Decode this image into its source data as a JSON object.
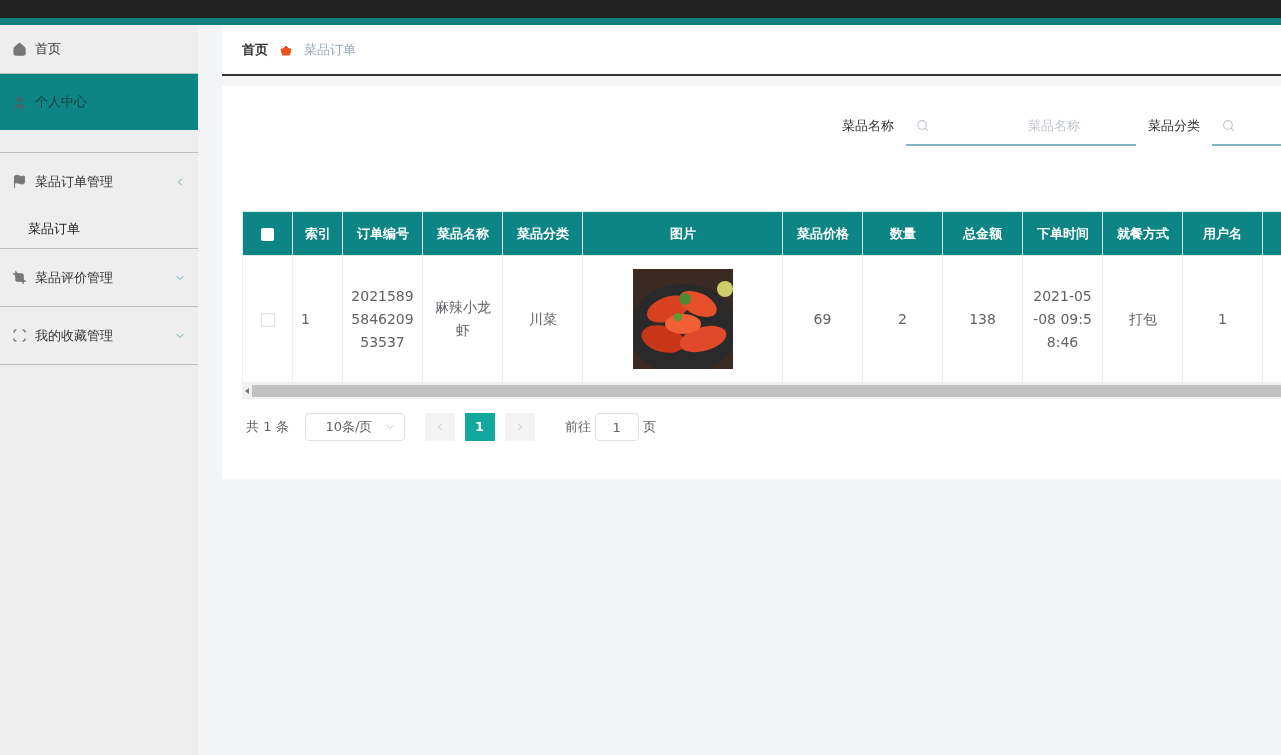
{
  "sidebar": {
    "items": [
      {
        "label": "首页",
        "selected": false
      },
      {
        "label": "个人中心",
        "selected": true
      },
      {
        "label": "菜品订单管理",
        "selected": false,
        "expanded": true,
        "children": [
          {
            "label": "菜品订单",
            "selected": true
          }
        ]
      },
      {
        "label": "菜品评价管理",
        "selected": false,
        "expanded": false
      },
      {
        "label": "我的收藏管理",
        "selected": false,
        "expanded": false
      }
    ]
  },
  "breadcrumb": [
    {
      "label": "首页"
    },
    {
      "label": "菜品订单"
    }
  ],
  "search": [
    {
      "label": "菜品名称",
      "placeholder": "菜品名称"
    },
    {
      "label": "菜品分类"
    }
  ],
  "table": {
    "select_all": {
      "checked": false
    },
    "columns": [
      "索引",
      "订单编号",
      "菜品名称",
      "菜品分类",
      "图片",
      "菜品价格",
      "数量",
      "总金额",
      "下单时间",
      "就餐方式",
      "用户名"
    ],
    "rows": [
      {
        "checked": false,
        "cells": [
          "1",
          "2021589584620953537",
          "麻辣小龙虾",
          "川菜",
          {
            "kind": "picture"
          },
          "69",
          "2",
          "138",
          "2021-05-08 09:58:46",
          "打包",
          "1"
        ]
      }
    ]
  },
  "pagination": {
    "total": "共 1 条",
    "page_size": "10条/页",
    "pages": [
      {
        "label": "1",
        "selected": true
      }
    ],
    "goto_label": "前往",
    "goto_value": "1",
    "goto_suffix": "页"
  }
}
